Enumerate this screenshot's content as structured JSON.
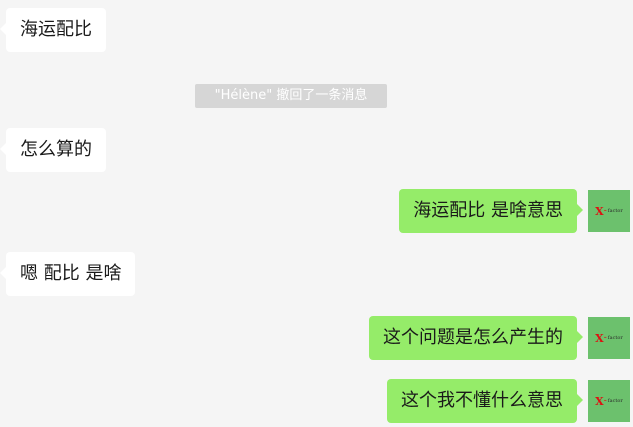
{
  "system_notice": "\"Hélène\" 撤回了一条消息",
  "messages": [
    {
      "side": "left",
      "text": "海运配比"
    },
    {
      "side": "left",
      "text": "怎么算的"
    },
    {
      "side": "right",
      "text": "海运配比 是啥意思"
    },
    {
      "side": "left",
      "text": "嗯 配比 是啥"
    },
    {
      "side": "right",
      "text": "这个问题是怎么产生的"
    },
    {
      "side": "right",
      "text": "这个我不懂什么意思"
    }
  ],
  "avatar": {
    "logo_x": "X",
    "logo_dash": "-",
    "logo_text": "factor",
    "bg_color": "#6cc16d"
  },
  "colors": {
    "background": "#f5f5f5",
    "incoming_bubble": "#ffffff",
    "outgoing_bubble": "#95ec69",
    "notice_bg": "#d6d6d6"
  }
}
